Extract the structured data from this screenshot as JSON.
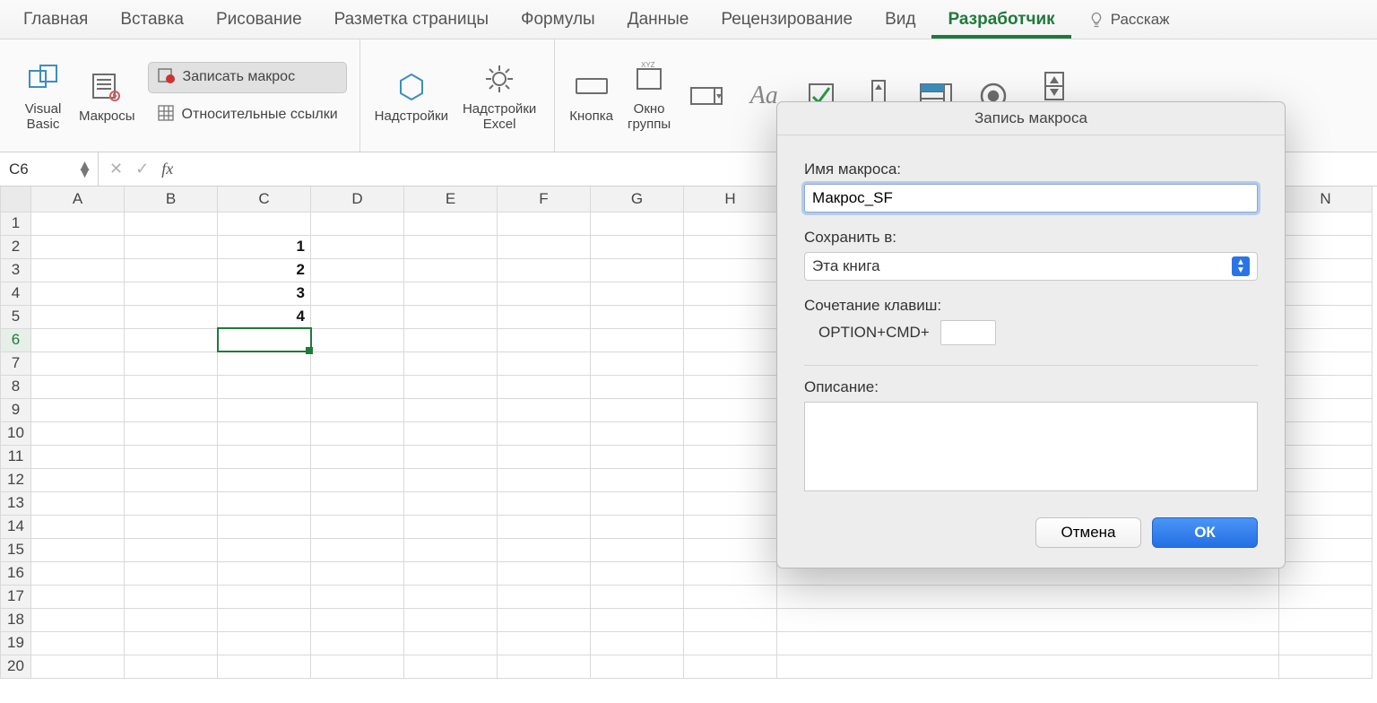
{
  "menu": {
    "tabs": [
      "Главная",
      "Вставка",
      "Рисование",
      "Разметка страницы",
      "Формулы",
      "Данные",
      "Рецензирование",
      "Вид",
      "Разработчик"
    ],
    "active_index": 8,
    "tell_me": "Расскаж"
  },
  "ribbon": {
    "visual_basic": "Visual\nBasic",
    "macros": "Макросы",
    "record_macro": "Записать макрос",
    "relative_refs": "Относительные ссылки",
    "addins": "Надстройки",
    "excel_addins": "Надстройки\nExcel",
    "button_ctrl": "Кнопка",
    "group_window": "Окно\nгруппы",
    "counter": "Счетчик"
  },
  "formula_bar": {
    "namebox": "C6",
    "fx": "fx",
    "value": ""
  },
  "sheet": {
    "columns": [
      "A",
      "B",
      "C",
      "D",
      "E",
      "F",
      "G",
      "H",
      "N"
    ],
    "rows": 20,
    "active_row": 6,
    "selected_cell": "C6",
    "cells": {
      "C2": "1",
      "C3": "2",
      "C4": "3",
      "C5": "4"
    }
  },
  "dialog": {
    "title": "Запись макроса",
    "name_label": "Имя макроса:",
    "name_value": "Макрос_SF",
    "store_label": "Сохранить в:",
    "store_value": "Эта книга",
    "shortcut_label": "Сочетание клавиш:",
    "shortcut_prefix": "OPTION+CMD+",
    "shortcut_value": "",
    "description_label": "Описание:",
    "description_value": "",
    "cancel": "Отмена",
    "ok": "ОК"
  }
}
